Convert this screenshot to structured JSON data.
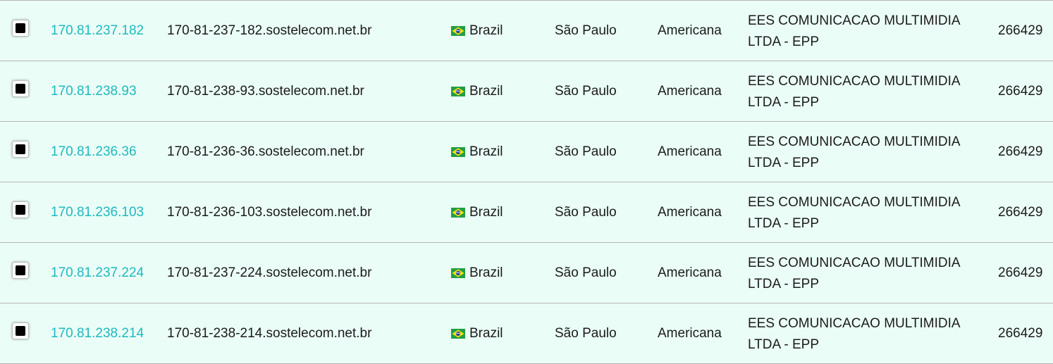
{
  "colors": {
    "row_background": "#eafdf7",
    "ip_link": "#1fb9c0",
    "divider": "#b5b5b5",
    "text": "#1b1b1b"
  },
  "rows": [
    {
      "checked": true,
      "ip": "170.81.237.182",
      "hostname": "170-81-237-182.sostelecom.net.br",
      "flag_icon": "brazil-flag-icon",
      "country": "Brazil",
      "region": "São Paulo",
      "city": "Americana",
      "isp": "EES COMUNICACAO MULTIMIDIA LTDA - EPP",
      "asn": "266429"
    },
    {
      "checked": true,
      "ip": "170.81.238.93",
      "hostname": "170-81-238-93.sostelecom.net.br",
      "flag_icon": "brazil-flag-icon",
      "country": "Brazil",
      "region": "São Paulo",
      "city": "Americana",
      "isp": "EES COMUNICACAO MULTIMIDIA LTDA - EPP",
      "asn": "266429"
    },
    {
      "checked": true,
      "ip": "170.81.236.36",
      "hostname": "170-81-236-36.sostelecom.net.br",
      "flag_icon": "brazil-flag-icon",
      "country": "Brazil",
      "region": "São Paulo",
      "city": "Americana",
      "isp": "EES COMUNICACAO MULTIMIDIA LTDA - EPP",
      "asn": "266429"
    },
    {
      "checked": true,
      "ip": "170.81.236.103",
      "hostname": "170-81-236-103.sostelecom.net.br",
      "flag_icon": "brazil-flag-icon",
      "country": "Brazil",
      "region": "São Paulo",
      "city": "Americana",
      "isp": "EES COMUNICACAO MULTIMIDIA LTDA - EPP",
      "asn": "266429"
    },
    {
      "checked": true,
      "ip": "170.81.237.224",
      "hostname": "170-81-237-224.sostelecom.net.br",
      "flag_icon": "brazil-flag-icon",
      "country": "Brazil",
      "region": "São Paulo",
      "city": "Americana",
      "isp": "EES COMUNICACAO MULTIMIDIA LTDA - EPP",
      "asn": "266429"
    },
    {
      "checked": true,
      "ip": "170.81.238.214",
      "hostname": "170-81-238-214.sostelecom.net.br",
      "flag_icon": "brazil-flag-icon",
      "country": "Brazil",
      "region": "São Paulo",
      "city": "Americana",
      "isp": "EES COMUNICACAO MULTIMIDIA LTDA - EPP",
      "asn": "266429"
    }
  ]
}
